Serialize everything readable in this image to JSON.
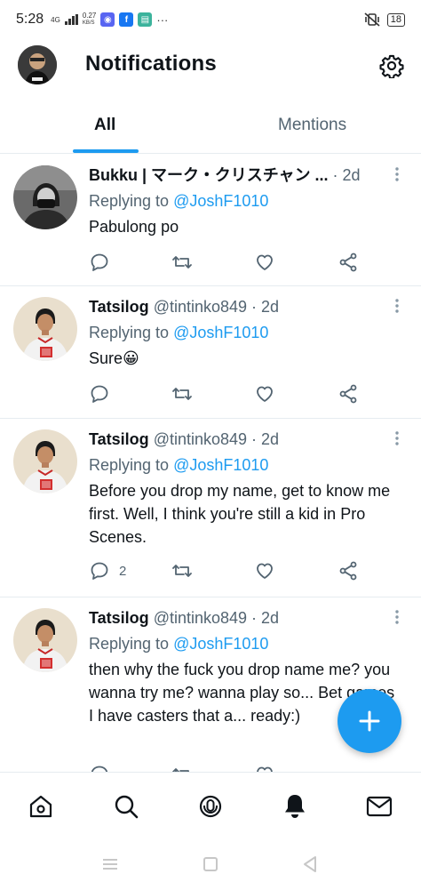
{
  "status_bar": {
    "time": "5:28",
    "network": "4G",
    "speed_value": "0.27",
    "speed_unit": "KB/S",
    "battery": "18",
    "overflow": "···"
  },
  "header": {
    "title": "Notifications"
  },
  "tabs": [
    {
      "label": "All",
      "active": true
    },
    {
      "label": "Mentions",
      "active": false
    }
  ],
  "tweets": [
    {
      "name": "Bukku | マーク・クリスチャン ...",
      "handle": "",
      "time": "· 2d",
      "reply_prefix": "Replying to",
      "reply_to": "@JoshF1010",
      "text": "Pabulong po",
      "reply_count": "",
      "retweet_count": "",
      "like_count": ""
    },
    {
      "name": "Tatsilog",
      "handle": "@tintinko849",
      "time": "· 2d",
      "reply_prefix": "Replying to",
      "reply_to": "@JoshF1010",
      "text": "Sure😀",
      "reply_count": "",
      "retweet_count": "",
      "like_count": ""
    },
    {
      "name": "Tatsilog",
      "handle": "@tintinko849",
      "time": "· 2d",
      "reply_prefix": "Replying to",
      "reply_to": "@JoshF1010",
      "text": "Before you drop my name, get to know me first. Well, I think you're still a kid in Pro Scenes.",
      "reply_count": "2",
      "retweet_count": "",
      "like_count": ""
    },
    {
      "name": "Tatsilog",
      "handle": "@tintinko849",
      "time": "· 2d",
      "reply_prefix": "Replying to",
      "reply_to": "@JoshF1010",
      "text": "then why the fuck you drop name me? you wanna try me? wanna play so... Bet games I have casters that a... ready:)",
      "reply_count": "",
      "retweet_count": "",
      "like_count": ""
    }
  ],
  "icons": {
    "gear": "settings-icon",
    "fab": "compose-plus-icon",
    "nav": [
      "home-icon",
      "search-icon",
      "spaces-icon",
      "notifications-bell-icon",
      "messages-icon"
    ]
  },
  "colors": {
    "accent": "#1d9bf0",
    "text": "#0f1419",
    "secondary": "#536471",
    "divider": "#e6ecf0"
  }
}
